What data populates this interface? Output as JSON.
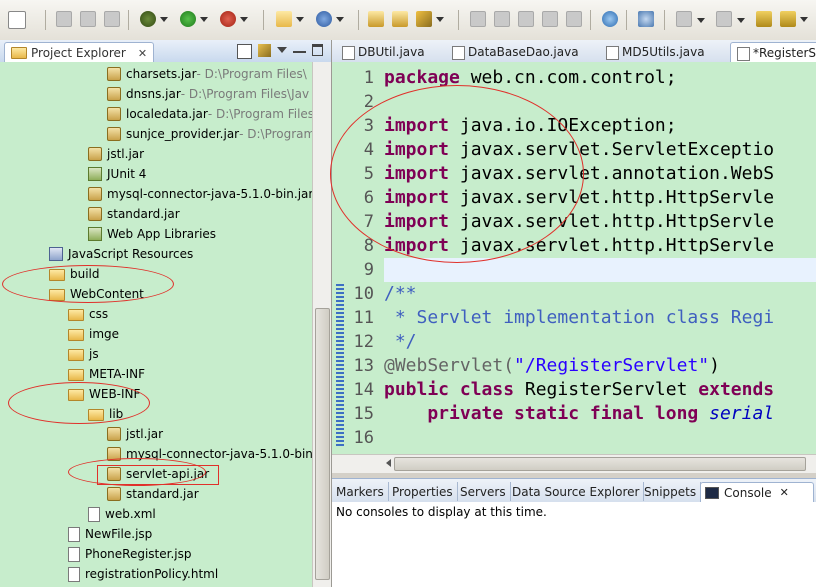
{
  "project_explorer": {
    "title": "Project Explorer",
    "tree": [
      {
        "label": "charsets.jar",
        "location": " - D:\\Program Files\\",
        "icon": "jar-icon"
      },
      {
        "label": "dnsns.jar",
        "location": " - D:\\Program Files\\Jav",
        "icon": "jar-icon"
      },
      {
        "label": "localedata.jar",
        "location": " - D:\\Program Files\\",
        "icon": "jar-icon"
      },
      {
        "label": "sunjce_provider.jar",
        "location": " - D:\\Program",
        "icon": "jar-icon"
      },
      {
        "label": "jstl.jar",
        "location": "",
        "icon": "jar-icon"
      },
      {
        "label": "JUnit 4",
        "location": "",
        "icon": "library-icon"
      },
      {
        "label": "mysql-connector-java-5.1.0-bin.jar",
        "location": "",
        "icon": "jar-icon"
      },
      {
        "label": "standard.jar",
        "location": "",
        "icon": "jar-icon"
      },
      {
        "label": "Web App Libraries",
        "location": "",
        "icon": "library-icon"
      },
      {
        "label": "JavaScript Resources",
        "location": "",
        "icon": "javascript-resources-icon"
      },
      {
        "label": "build",
        "location": "",
        "icon": "folder-icon"
      },
      {
        "label": "WebContent",
        "location": "",
        "icon": "folder-icon"
      },
      {
        "label": "css",
        "location": "",
        "icon": "folder-icon"
      },
      {
        "label": "imge",
        "location": "",
        "icon": "folder-icon"
      },
      {
        "label": "js",
        "location": "",
        "icon": "folder-icon"
      },
      {
        "label": "META-INF",
        "location": "",
        "icon": "folder-icon"
      },
      {
        "label": "WEB-INF",
        "location": "",
        "icon": "folder-icon"
      },
      {
        "label": "lib",
        "location": "",
        "icon": "folder-icon"
      },
      {
        "label": "jstl.jar",
        "location": "",
        "icon": "jar-icon"
      },
      {
        "label": "mysql-connector-java-5.1.0-bin.",
        "location": "",
        "icon": "jar-icon"
      },
      {
        "label": "servlet-api.jar",
        "location": "",
        "icon": "jar-icon"
      },
      {
        "label": "standard.jar",
        "location": "",
        "icon": "jar-icon"
      },
      {
        "label": "web.xml",
        "location": "",
        "icon": "xml-file-icon"
      },
      {
        "label": "NewFile.jsp",
        "location": "",
        "icon": "jsp-file-icon"
      },
      {
        "label": "PhoneRegister.jsp",
        "location": "",
        "icon": "jsp-file-icon"
      },
      {
        "label": "registrationPolicy.html",
        "location": "",
        "icon": "html-file-icon"
      }
    ]
  },
  "editor": {
    "tabs": [
      {
        "label": "DBUtil.java"
      },
      {
        "label": "DataBaseDao.java"
      },
      {
        "label": "MD5Utils.java"
      },
      {
        "label": "*RegisterSe"
      }
    ],
    "line_numbers": [
      "1",
      "2",
      "3",
      "4",
      "5",
      "6",
      "7",
      "8",
      "9",
      "10",
      "11",
      "12",
      "13",
      "14",
      "15",
      "16"
    ],
    "lines": {
      "l1_kw": "package",
      "l1_rest": " web.cn.com.control;",
      "l3_kw": "import",
      "l3_rest": " java.io.IOException;",
      "l4_kw": "import",
      "l4_rest": " javax.servlet.ServletExceptio",
      "l5_kw": "import",
      "l5_rest": " javax.servlet.annotation.WebS",
      "l6_kw": "import",
      "l6_rest": " javax.servlet.http.HttpServle",
      "l7_kw": "import",
      "l7_rest": " javax.servlet.http.HttpServle",
      "l8_kw": "import",
      "l8_rest": " javax.servlet.http.HttpServle",
      "l10": "/**",
      "l11": " * Servlet implementation class Regi",
      "l12": " */",
      "l13_ann": "@WebServlet(",
      "l13_str": "\"/RegisterServlet\"",
      "l13_end": ")",
      "l14_kw1": "public class",
      "l14_mid": " RegisterServlet ",
      "l14_kw2": "extends",
      "l15_kw": "    private static final long",
      "l15_field": " serial"
    }
  },
  "console_panel": {
    "tabs": [
      {
        "label": "Markers"
      },
      {
        "label": "Properties"
      },
      {
        "label": "Servers"
      },
      {
        "label": "Data Source Explorer"
      },
      {
        "label": "Snippets"
      },
      {
        "label": "Console"
      }
    ],
    "message": "No consoles to display at this time."
  },
  "colors": {
    "editor_background": "#c7edcc",
    "annotation_mark": "#e0302a",
    "keyword": "#7f0055",
    "comment": "#3f5fbf",
    "string": "#2a00ff"
  }
}
